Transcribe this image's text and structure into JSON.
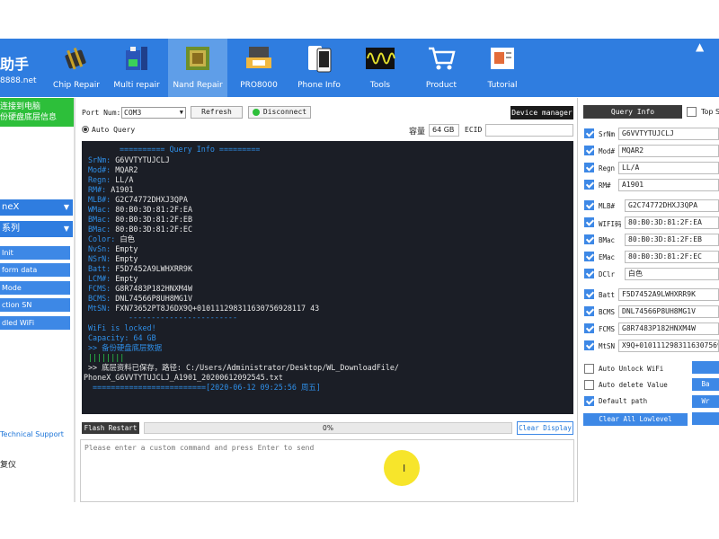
{
  "brand": {
    "title": "助手",
    "sub": "8888.net"
  },
  "nav": [
    {
      "label": "Chip Repair",
      "icon": "chip-repair-icon"
    },
    {
      "label": "Multi repair",
      "icon": "multi-repair-icon"
    },
    {
      "label": "Nand Repair",
      "icon": "nand-chip-icon",
      "active": true
    },
    {
      "label": "PRO8000",
      "icon": "programmer-device-icon"
    },
    {
      "label": "Phone Info",
      "icon": "phone-icon"
    },
    {
      "label": "Tools",
      "icon": "oscilloscope-icon"
    },
    {
      "label": "Product",
      "icon": "cart-icon"
    },
    {
      "label": "Tutorial",
      "icon": "tutorial-icon"
    }
  ],
  "left": {
    "green_line1": "连接到电脑",
    "green_line2": "份硬盘底层信息",
    "dropdown1": "neX",
    "dropdown2": "系列",
    "buttons": [
      "Init",
      "form data",
      "Mode",
      "ction SN",
      "dled WiFi"
    ],
    "tech_support": "Technical Support",
    "bottom_label": "复仪"
  },
  "controls": {
    "port_label": "Port Num:",
    "port_value": "COM3",
    "refresh": "Refresh",
    "disconnect": "Disconnect",
    "device_manager": "Device manager",
    "auto_query": "Auto Query",
    "capacity_label": "容量",
    "capacity_value": "64 GB",
    "ecid_label": "ECID",
    "ecid_value": ""
  },
  "console": {
    "header": "========== Query Info =========",
    "fields": [
      {
        "k": "SrNm:",
        "v": "G6VVTYTUJCLJ"
      },
      {
        "k": "Mod#:",
        "v": "MQAR2"
      },
      {
        "k": "Regn:",
        "v": "LL/A"
      },
      {
        "k": "RM#:",
        "v": "A1901"
      },
      {
        "k": "MLB#:",
        "v": "G2C74772DHXJ3QPA"
      },
      {
        "k": "WMac:",
        "v": "80:B0:3D:81:2F:EA"
      },
      {
        "k": "BMac:",
        "v": "80:B0:3D:81:2F:EB"
      },
      {
        "k": "BMac:",
        "v": "80:B0:3D:81:2F:EC"
      },
      {
        "k": "Color:",
        "v": "白色"
      },
      {
        "k": "NvSn:",
        "v": "Empty"
      },
      {
        "k": "NSrN:",
        "v": "Empty"
      },
      {
        "k": "Batt:",
        "v": "F5D7452A9LWHXRR9K"
      },
      {
        "k": "LCM#:",
        "v": "Empty"
      },
      {
        "k": "FCMS:",
        "v": "G8R7483P182HNXM4W"
      },
      {
        "k": "BCMS:",
        "v": "DNL74566P8UH8MG1V"
      },
      {
        "k": "MtSN:",
        "v": "FXN73652PT8J6DX9Q+010111298311630756928117 43"
      }
    ],
    "divider": "------------------------",
    "wifi_locked": "WiFi is locked!",
    "capacity": "Capacity: 64 GB",
    "backup": ">> 备份硬盘底层数据",
    "bars": "||||||||",
    "saved": ">> 底层资料已保存，路径: C:/Users/Administrator/Desktop/WL_DownloadFile/",
    "saved_file": "PhoneX_G6VVTYTUJCLJ_A1901_20200612092545.txt",
    "footer": "=========================[2020-06-12 09:25:56 周五]"
  },
  "progress": {
    "flash_restart": "Flash Restart",
    "percent_label": "0%",
    "percent": 0,
    "clear_display": "Clear Display",
    "cmd_placeholder": "Please enter a custom command and press Enter to send"
  },
  "right": {
    "query_info": "Query Info",
    "top_label": "Top S",
    "rows": [
      {
        "label": "SrNm",
        "value": "G6VVTYTUJCLJ"
      },
      {
        "label": "Mod#",
        "value": "MQAR2"
      },
      {
        "label": "Regn",
        "value": "LL/A"
      },
      {
        "label": "RM#",
        "value": "A1901"
      },
      {
        "label": "MLB#",
        "value": "G2C74772DHXJ3QPA"
      },
      {
        "label": "WIFI码",
        "value": "80:B0:3D:81:2F:EA"
      },
      {
        "label": "BMac",
        "value": "80:B0:3D:81:2F:EB"
      },
      {
        "label": "EMac",
        "value": "80:B0:3D:81:2F:EC"
      },
      {
        "label": "DClr",
        "value": "白色"
      },
      {
        "label": "Batt",
        "value": "F5D7452A9LWHXRR9K"
      },
      {
        "label": "BCMS",
        "value": "DNL74566P8UH8MG1V"
      },
      {
        "label": "FCMS",
        "value": "G8R7483P182HNXM4W"
      },
      {
        "label": "MtSN",
        "value": "X9Q+0101112983116307569"
      }
    ],
    "auto_unlock": "Auto Unlock WiFi",
    "auto_delete": "Auto delete Value",
    "default_path": "Default path",
    "clear_lowlevel": "Clear All Lowlevel",
    "side_btn1": "",
    "side_btn2": "Ba",
    "side_btn3": "Wr",
    "side_btn4": ""
  }
}
